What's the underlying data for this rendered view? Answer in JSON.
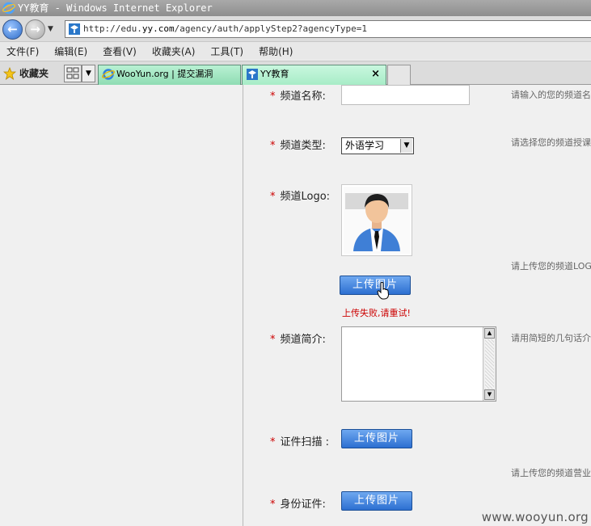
{
  "window": {
    "title": "YY教育 - Windows Internet Explorer"
  },
  "address": {
    "url_prefix": "http://edu.",
    "url_host": "yy.com",
    "url_rest": "/agency/auth/applyStep2?agencyType=1"
  },
  "menu": [
    "文件(F)",
    "编辑(E)",
    "查看(V)",
    "收藏夹(A)",
    "工具(T)",
    "帮助(H)"
  ],
  "favorites_label": "收藏夹",
  "tabs": [
    {
      "label": "WooYun.org | 提交漏洞"
    },
    {
      "label": "YY教育",
      "close": "×"
    }
  ],
  "form": {
    "required_mark": "*",
    "name": {
      "label": "频道名称:",
      "value": "",
      "hint": "请输入的您的频道名"
    },
    "type": {
      "label": "频道类型:",
      "selected": "外语学习",
      "hint": "请选择您的频道授课"
    },
    "logo": {
      "label": "频道Logo:",
      "hint": "请上传您的频道LOG",
      "upload_label": "上传图片",
      "error": "上传失败,请重试!"
    },
    "intro": {
      "label": "频道简介:",
      "hint": "请用简短的几句话介"
    },
    "license": {
      "label": "证件扫描 :",
      "upload_label": "上传图片",
      "hint": "请上传您的频道营业"
    },
    "id_card": {
      "label": "身份证件:",
      "upload_label": "上传图片"
    }
  },
  "watermark": "www.wooyun.org",
  "colors": {
    "accent_button": "#2c6fd1",
    "required": "#cc0000",
    "tab_active": "#a7ecc7"
  }
}
